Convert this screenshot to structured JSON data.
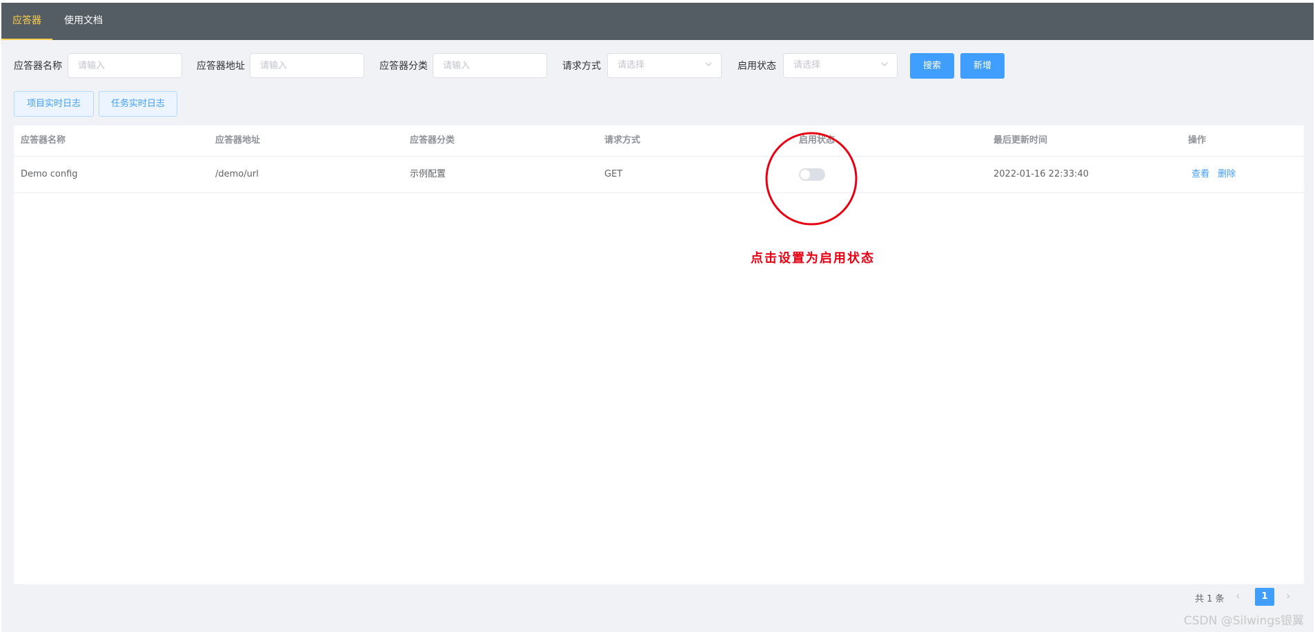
{
  "nav": {
    "items": [
      {
        "label": "应答器",
        "active": true
      },
      {
        "label": "使用文档",
        "active": false
      }
    ]
  },
  "filters": {
    "name_label": "应答器名称",
    "name_placeholder": "请输入",
    "address_label": "应答器地址",
    "address_placeholder": "请输入",
    "category_label": "应答器分类",
    "category_placeholder": "请输入",
    "method_label": "请求方式",
    "method_placeholder": "请选择",
    "status_label": "启用状态",
    "status_placeholder": "请选择",
    "search_button": "搜索",
    "add_button": "新增"
  },
  "log_buttons": {
    "project_log": "项目实时日志",
    "task_log": "任务实时日志"
  },
  "table": {
    "headers": [
      "应答器名称",
      "应答器地址",
      "应答器分类",
      "请求方式",
      "启用状态",
      "最后更新时间",
      "操作"
    ],
    "rows": [
      {
        "name": "Demo config",
        "address": "/demo/url",
        "category": "示例配置",
        "method": "GET",
        "enabled": false,
        "updated_at": "2022-01-16 22:33:40",
        "actions": [
          "查看",
          "删除"
        ]
      }
    ]
  },
  "pagination": {
    "total_text": "共 1 条",
    "current_page": "1",
    "prev_icon": "chevron-left-icon",
    "next_icon": "chevron-right-icon"
  },
  "annotation": {
    "text": "点击设置为启用状态",
    "color": "#e60012"
  },
  "watermark": "CSDN @Silwings银翼",
  "colors": {
    "nav_bg": "#545c64",
    "nav_active": "#ffd04b",
    "primary": "#409eff",
    "page_bg": "#f0f2f5"
  }
}
